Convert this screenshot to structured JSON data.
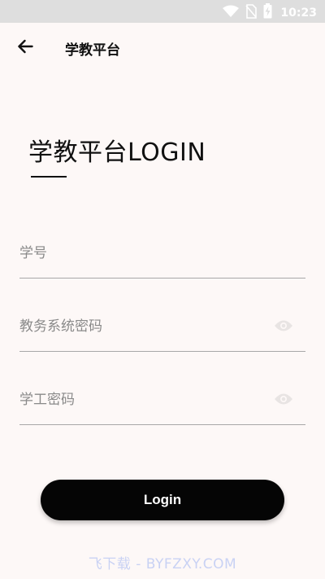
{
  "status_bar": {
    "time": "10:23",
    "icons": [
      "wifi-icon",
      "sim-no-signal-icon",
      "battery-charging-icon"
    ]
  },
  "app_bar": {
    "back_icon": "arrow-left-icon",
    "title": "学教平台"
  },
  "login": {
    "heading": "学教平台LOGIN",
    "student_id_placeholder": "学号",
    "academic_password_placeholder": "教务系统密码",
    "student_affairs_password_placeholder": "学工密码",
    "visibility_icon": "eye-icon",
    "submit_label": "Login"
  },
  "watermark": "飞下载 - BYFZXY.COM",
  "colors": {
    "background": "#fdf8f7",
    "status_bar": "#dedede",
    "button": "#050505",
    "input_line": "#a8a8a8",
    "placeholder": "#8a8a8a",
    "watermark": "#c9d2f4"
  }
}
